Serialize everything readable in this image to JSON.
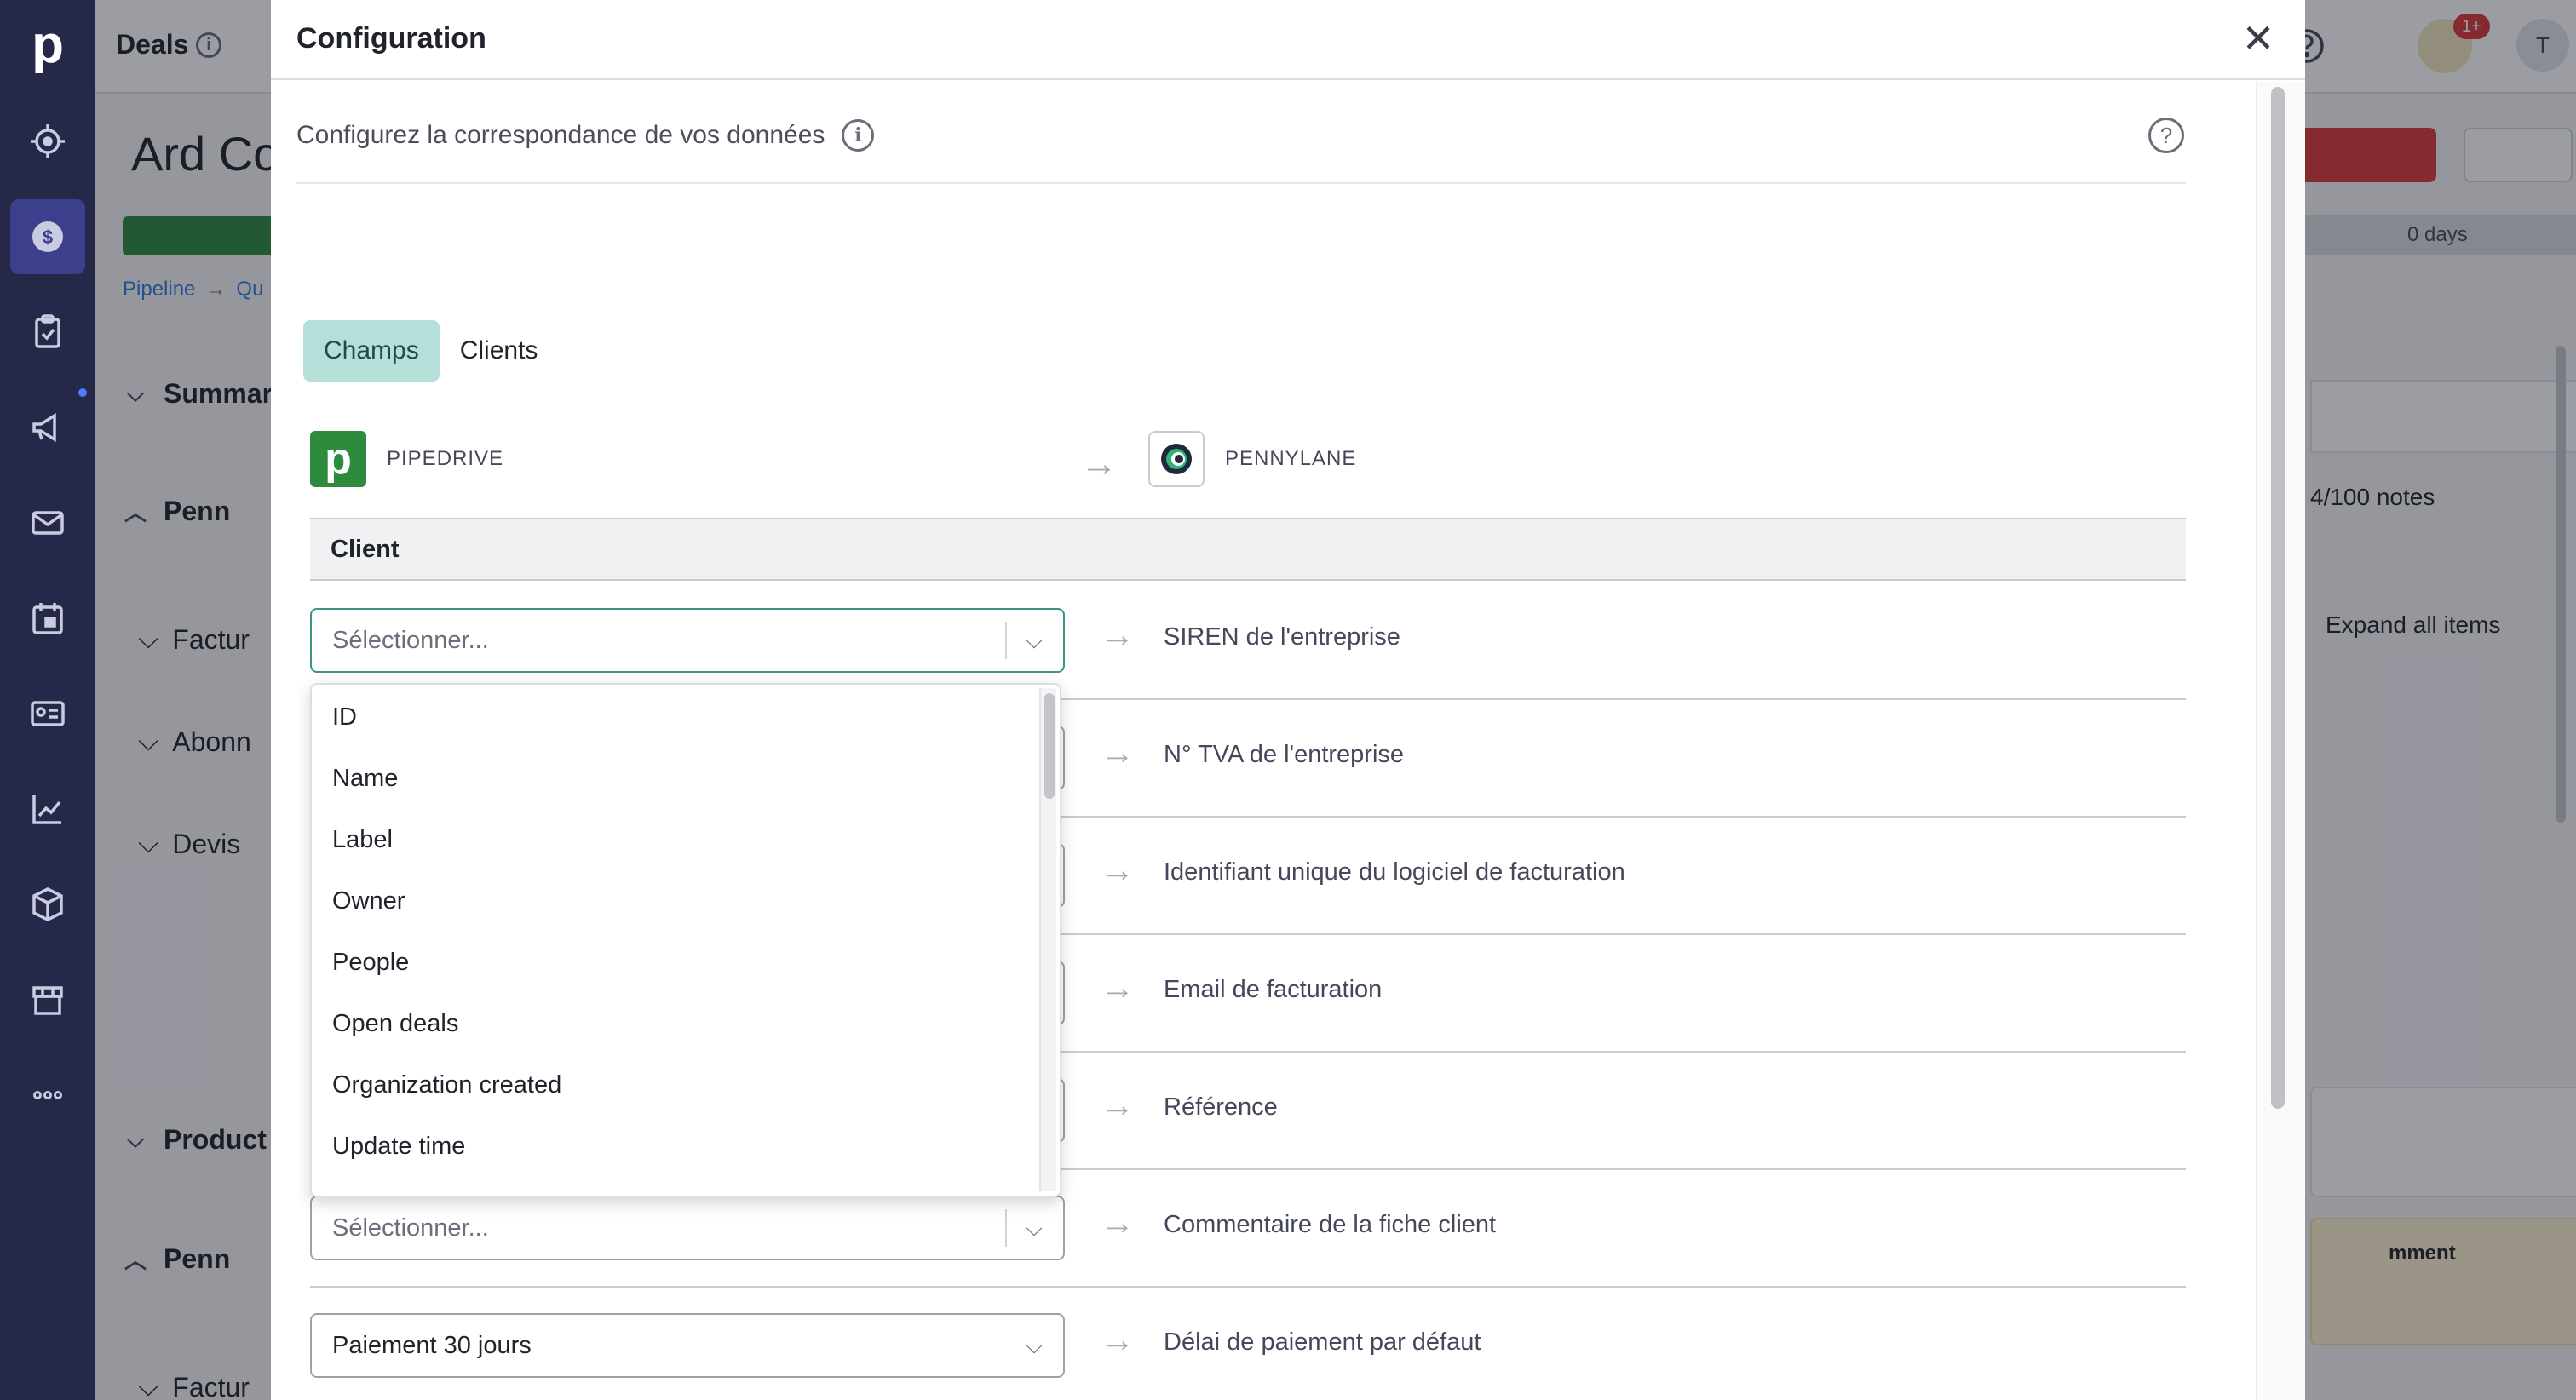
{
  "rail": {
    "logo": "p",
    "items": [
      {
        "icon": "target-icon"
      },
      {
        "icon": "dollar-icon"
      },
      {
        "icon": "clipboard-icon"
      },
      {
        "icon": "megaphone-icon"
      },
      {
        "icon": "mail-icon"
      },
      {
        "icon": "calendar-icon"
      },
      {
        "icon": "contacts-card-icon"
      },
      {
        "icon": "chart-icon"
      },
      {
        "icon": "box-icon"
      },
      {
        "icon": "store-icon"
      },
      {
        "icon": "more-icon"
      }
    ]
  },
  "page": {
    "breadcrumb": "Deals",
    "deal_title": "Ard Co",
    "pipeline_crumb": "Pipeline",
    "pipeline_crumb_next": "Qu",
    "sections": {
      "summary": "Summar",
      "penny1": "Penn",
      "factures1": "Factur",
      "abonnements": "Abonn",
      "devis": "Devis",
      "products": "Product",
      "penny2": "Penn",
      "factures2": "Factur"
    },
    "days_label": "0 days",
    "notes_label": "4/100 notes",
    "expand_label": "Expand all items",
    "comment_label": "mment",
    "avatar_initial": "T",
    "badge": "1+"
  },
  "modal": {
    "title": "Configuration",
    "subtitle": "Configurez la correspondance de vos données",
    "tabs": [
      "Champs",
      "Clients"
    ],
    "source_system": "PIPEDRIVE",
    "target_system": "PENNYLANE",
    "group_label": "Client",
    "placeholder": "Sélectionner...",
    "rows": [
      {
        "value": "Sélectionner...",
        "target": "SIREN de l'entreprise"
      },
      {
        "value": "",
        "target": "N° TVA de l'entreprise"
      },
      {
        "value": "",
        "target": "Identifiant unique du logiciel de facturation"
      },
      {
        "value": "",
        "target": "Email de facturation"
      },
      {
        "value": "",
        "target": "Référence"
      },
      {
        "value": "Sélectionner...",
        "target": "Commentaire de la fiche client"
      },
      {
        "value": "Paiement 30 jours",
        "target": "Délai de paiement par défaut"
      }
    ],
    "dropdown_options": [
      "ID",
      "Name",
      "Label",
      "Owner",
      "People",
      "Open deals",
      "Organization created",
      "Update time"
    ]
  },
  "colors": {
    "rail": "#26284a",
    "rail_active": "#3b3f8c",
    "tab_active_bg": "#b5e0da",
    "focus_border": "#3b9486",
    "pipedrive_green": "#2e8b3e",
    "danger": "#d73b3b"
  }
}
